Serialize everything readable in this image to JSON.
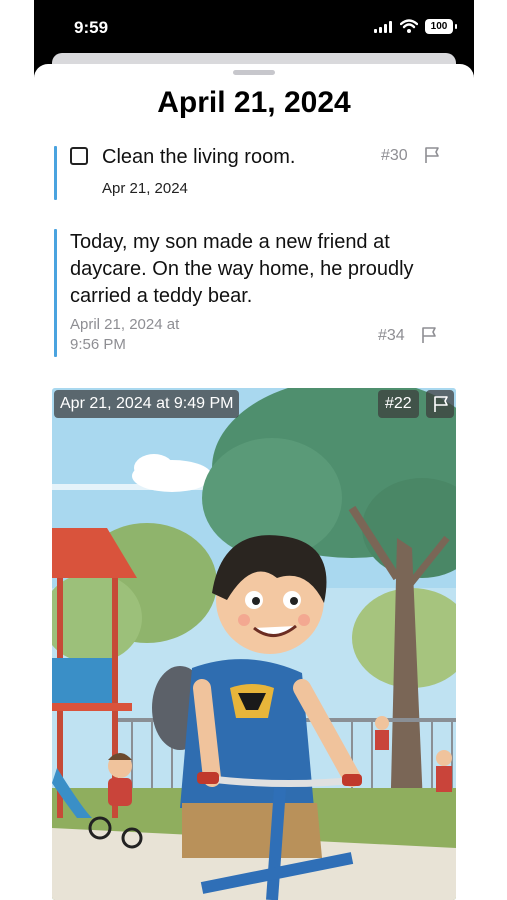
{
  "status_bar": {
    "time": "9:59",
    "battery": "100"
  },
  "sheet": {
    "title": "April 21, 2024"
  },
  "entries": [
    {
      "type": "task",
      "text": "Clean the living room.",
      "date": "Apr 21, 2024",
      "number": "#30"
    },
    {
      "type": "note",
      "text": "Today, my son made a new friend at daycare. On the way home, he proudly carried a teddy bear.",
      "date": "April 21, 2024 at 9:56 PM",
      "number": "#34"
    },
    {
      "type": "photo",
      "date": "Apr 21, 2024 at 9:49 PM",
      "number": "#22"
    }
  ],
  "colors": {
    "accent_bar": "#4aa3df"
  },
  "icons": [
    "signal-icon",
    "wifi-icon",
    "battery-icon",
    "checkbox-icon",
    "flag-icon"
  ]
}
